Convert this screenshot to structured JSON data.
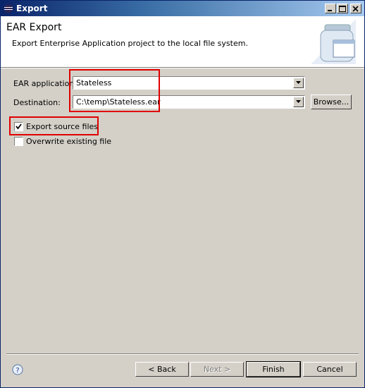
{
  "window": {
    "title": "Export"
  },
  "header": {
    "title": "EAR Export",
    "description": "Export Enterprise Application project to the local file system."
  },
  "form": {
    "ear_label": "EAR application:",
    "ear_value": "Stateless",
    "dest_label": "Destination:",
    "dest_value": "C:\\temp\\Stateless.ear",
    "browse_label": "Browse...",
    "export_source_label": "Export source files",
    "export_source_checked": true,
    "overwrite_label": "Overwrite existing file",
    "overwrite_checked": false
  },
  "footer": {
    "back_label": "< Back",
    "next_label": "Next >",
    "finish_label": "Finish",
    "cancel_label": "Cancel"
  },
  "colors": {
    "highlight": "#e00000",
    "titlebar": "#0a246a"
  }
}
